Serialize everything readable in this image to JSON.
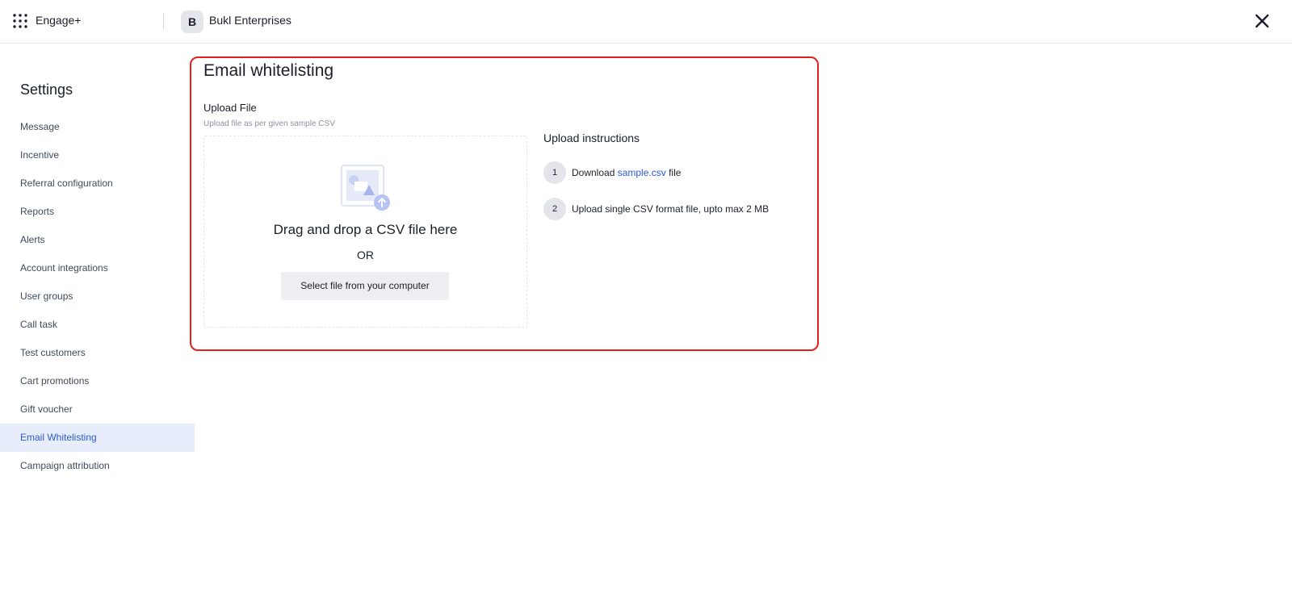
{
  "header": {
    "app_name": "Engage+",
    "org_initial": "B",
    "org_name": "Bukl Enterprises"
  },
  "sidebar": {
    "title": "Settings",
    "items": [
      {
        "label": "Message",
        "active": false
      },
      {
        "label": "Incentive",
        "active": false
      },
      {
        "label": "Referral configuration",
        "active": false
      },
      {
        "label": "Reports",
        "active": false
      },
      {
        "label": "Alerts",
        "active": false
      },
      {
        "label": "Account integrations",
        "active": false
      },
      {
        "label": "User groups",
        "active": false
      },
      {
        "label": "Call task",
        "active": false
      },
      {
        "label": "Test customers",
        "active": false
      },
      {
        "label": "Cart promotions",
        "active": false
      },
      {
        "label": "Gift voucher",
        "active": false
      },
      {
        "label": "Email Whitelisting",
        "active": true
      },
      {
        "label": "Campaign attribution",
        "active": false
      }
    ]
  },
  "main": {
    "title": "Email whitelisting",
    "upload": {
      "label": "Upload File",
      "hint": "Upload file as per given sample CSV",
      "drop_text": "Drag and drop a CSV file here",
      "or_text": "OR",
      "button_label": "Select file from your computer"
    },
    "instructions": {
      "title": "Upload instructions",
      "step1": {
        "num": "1",
        "prefix": "Download ",
        "link": "sample.csv",
        "suffix": " file"
      },
      "step2": {
        "num": "2",
        "text": "Upload single CSV format file, upto max 2 MB"
      }
    }
  },
  "colors": {
    "accent": "#2a5bd7",
    "active_bg": "#e8edfb",
    "highlight_border": "#e3201b"
  }
}
